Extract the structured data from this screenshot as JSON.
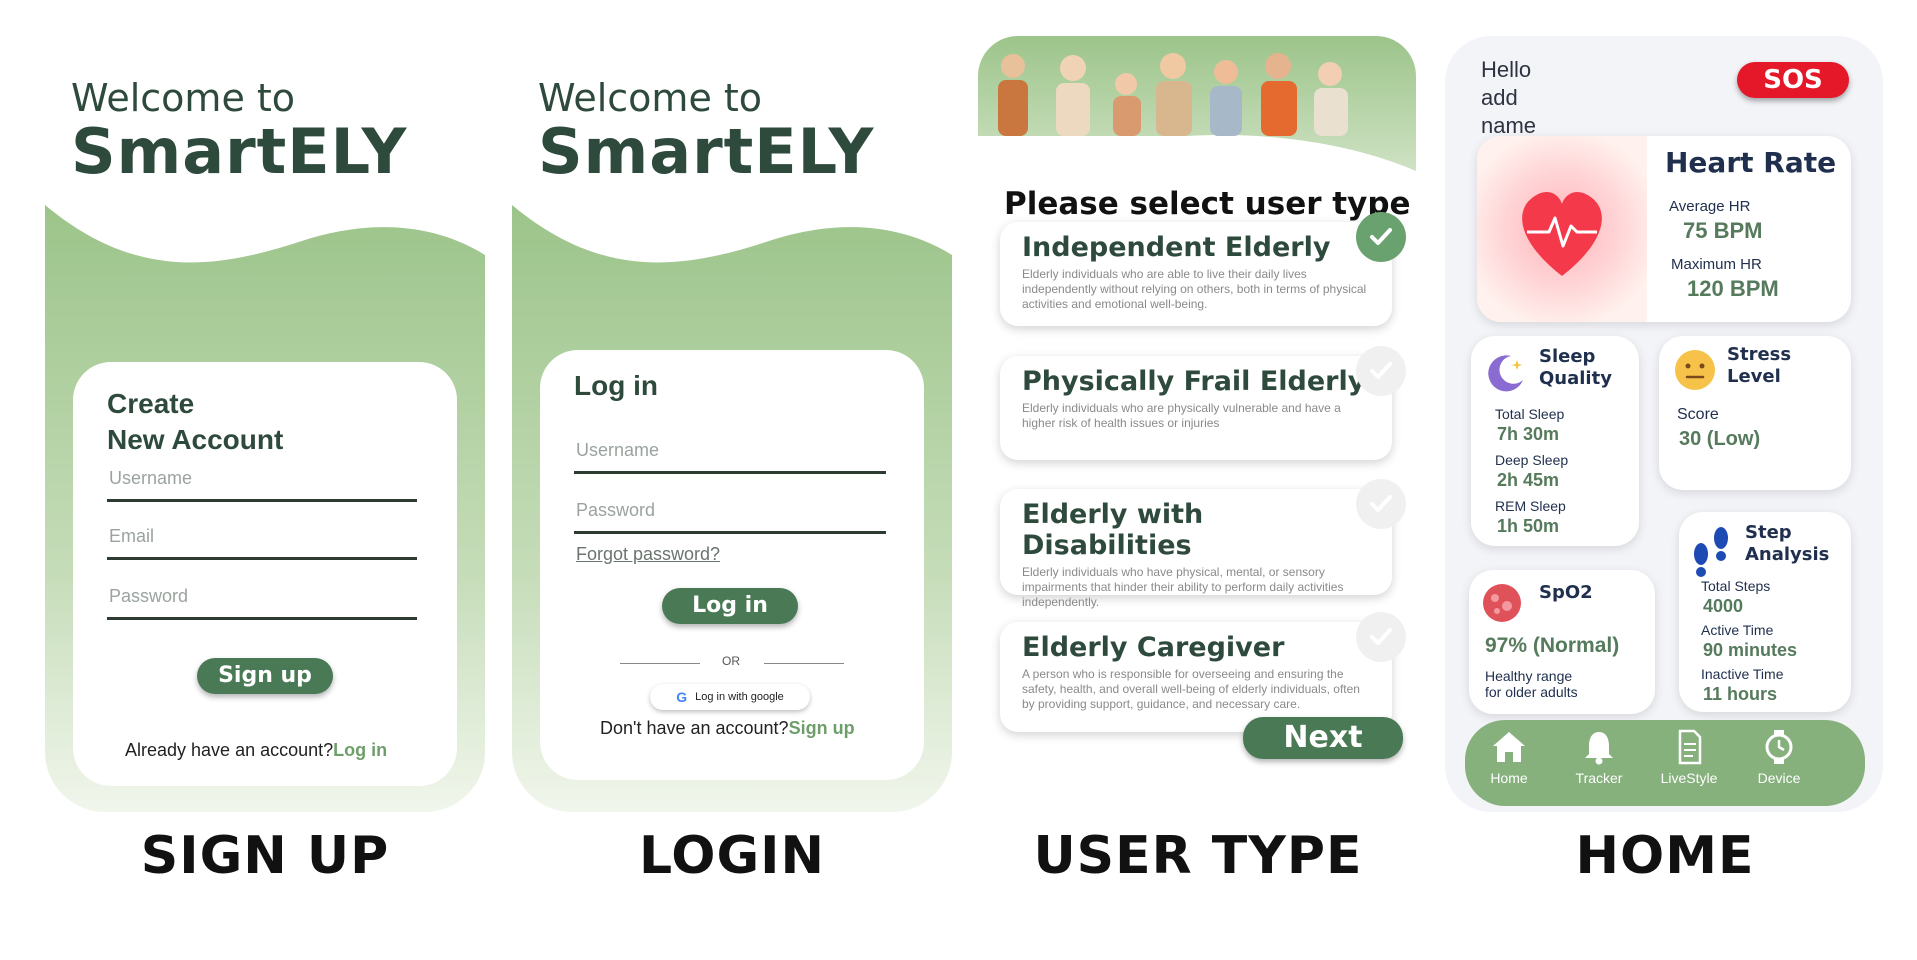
{
  "signup": {
    "welcome_line1": "Welcome to",
    "welcome_line2": "SmartELY",
    "card_title_line1": "Create",
    "card_title_line2": "New Account",
    "username_placeholder": "Username",
    "email_placeholder": "Email",
    "password_placeholder": "Password",
    "signup_button": "Sign up",
    "already_text": "Already have an account?",
    "login_link": "Log in",
    "caption": "SIGN UP"
  },
  "login": {
    "welcome_line1": "Welcome to",
    "welcome_line2": "SmartELY",
    "card_title": "Log in",
    "username_placeholder": "Username",
    "password_placeholder": "Password",
    "forgot_link": "Forgot password?",
    "login_button": "Log in",
    "or_text": "OR",
    "google_button": "Log in with google",
    "no_account_text": "Don't have an account?",
    "signup_link": "Sign up",
    "caption": "LOGIN"
  },
  "usertype": {
    "title": "Please select user type",
    "options": [
      {
        "title": "Independent Elderly",
        "desc": "Elderly individuals who are able to live their daily lives independently without relying on others, both in terms of physical activities and emotional well-being.",
        "selected": true
      },
      {
        "title": "Physically Frail Elderly",
        "desc": "Elderly individuals who are physically vulnerable and have a higher risk of health issues or injuries",
        "selected": false
      },
      {
        "title": "Elderly with Disabilities",
        "desc": "Elderly individuals who have physical, mental, or sensory impairments that hinder their ability to perform daily activities independently.",
        "selected": false
      },
      {
        "title": "Elderly Caregiver",
        "desc": "A person who is responsible for overseeing and ensuring the safety, health, and overall well-being of elderly individuals, often by providing support, guidance, and necessary care.",
        "selected": false
      }
    ],
    "next_button": "Next",
    "caption": "USER TYPE"
  },
  "home": {
    "greeting_line1": "Hello",
    "greeting_line2": "add",
    "greeting_line3": "name",
    "sos_button": "SOS",
    "heart_rate": {
      "title": "Heart Rate",
      "avg_label": "Average HR",
      "avg_value": "75 BPM",
      "max_label": "Maximum HR",
      "max_value": "120 BPM"
    },
    "sleep": {
      "title_line1": "Sleep",
      "title_line2": "Quality",
      "total_label": "Total Sleep",
      "total_value": "7h 30m",
      "deep_label": "Deep Sleep",
      "deep_value": "2h 45m",
      "rem_label": "REM Sleep",
      "rem_value": "1h 50m"
    },
    "stress": {
      "title_line1": "Stress",
      "title_line2": "Level",
      "score_label": "Score",
      "score_value": "30 (Low)"
    },
    "spo2": {
      "title": "SpO2",
      "value": "97% (Normal)",
      "note_line1": "Healthy range",
      "note_line2": "for older adults"
    },
    "steps": {
      "title_line1": "Step",
      "title_line2": "Analysis",
      "total_label": "Total Steps",
      "total_value": "4000",
      "active_label": "Active Time",
      "active_value": "90 minutes",
      "inactive_label": "Inactive Time",
      "inactive_value": "11 hours"
    },
    "nav": [
      "Home",
      "Tracker",
      "LiveStyle",
      "Device"
    ],
    "caption": "HOME"
  },
  "colors": {
    "primary_green": "#4a7a55",
    "accent_green": "#86b07c",
    "sos_red": "#e5182a",
    "dark_text": "#2e4a3c"
  }
}
